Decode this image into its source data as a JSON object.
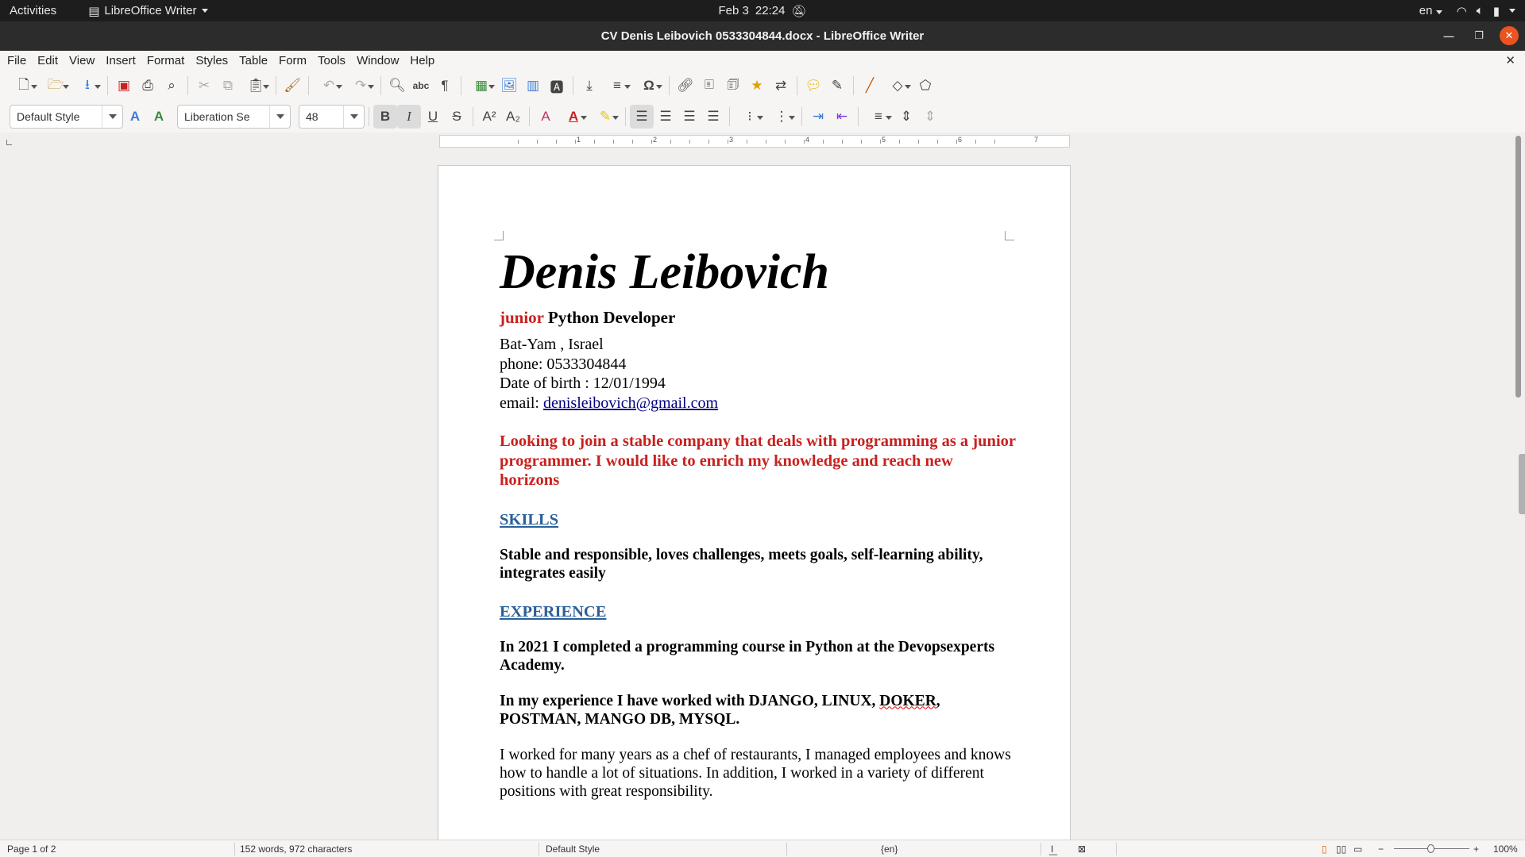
{
  "topbar": {
    "activities": "Activities",
    "app_name": "LibreOffice Writer",
    "date": "Feb 3",
    "time": "22:24",
    "language": "en"
  },
  "window": {
    "title": "CV Denis Leibovich 0533304844.docx - LibreOffice Writer"
  },
  "menu": {
    "items": [
      "File",
      "Edit",
      "View",
      "Insert",
      "Format",
      "Styles",
      "Table",
      "Form",
      "Tools",
      "Window",
      "Help"
    ]
  },
  "formatting": {
    "paragraph_style": "Default Style",
    "font_name": "Liberation Se",
    "font_size": "48"
  },
  "ruler": {
    "marks": [
      "1",
      "2",
      "3",
      "4",
      "5",
      "6",
      "7"
    ]
  },
  "document": {
    "name": "Denis Leibovich",
    "role_highlight": "junior",
    "role_rest": "Python Developer",
    "location": "Bat-Yam , Israel",
    "phone": "phone: 0533304844",
    "dob": "Date of birth : 12/01/1994",
    "email_label": "email: ",
    "email": "denisleibovich@gmail.com",
    "objective": "Looking to join a stable company that deals with programming as a junior programmer. I would like to enrich my knowledge and reach new horizons",
    "skills_heading": "SKILLS",
    "skills_text": "Stable and responsible, loves challenges, meets goals, self-learning ability, integrates easily",
    "experience_heading": "EXPERIENCE",
    "exp_course": "In 2021 I completed a programming course in Python at the Devopsexperts Academy.",
    "exp_tools_before": "In my experience I have worked with DJANGO, LINUX, ",
    "exp_tools_misspelled": "DOKER",
    "exp_tools_after": ", POSTMAN, MANGO DB, MYSQL.",
    "exp_chef": "I worked for many years as a chef of restaurants, I managed employees and knows how to handle a lot of situations. In addition, I worked in a variety of different positions with great responsibility."
  },
  "status": {
    "page": "Page 1 of 2",
    "words": "152 words, 972 characters",
    "style": "Default Style",
    "language": "{en}",
    "zoom": "100%"
  }
}
